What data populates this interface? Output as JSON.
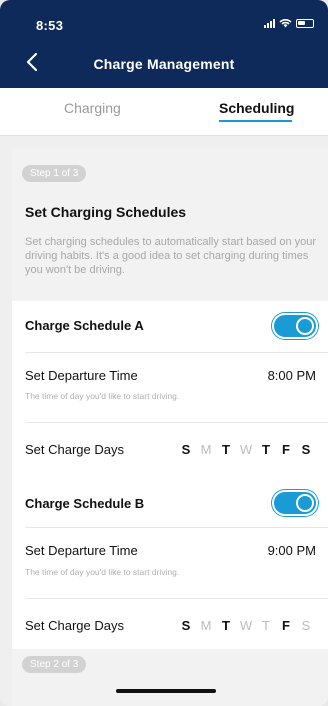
{
  "status_bar": {
    "time": "8:53"
  },
  "header": {
    "title": "Charge Management"
  },
  "tabs": [
    {
      "label": "Charging",
      "active": false
    },
    {
      "label": "Scheduling",
      "active": true
    }
  ],
  "step1": {
    "pill": "Step 1 of 3",
    "title": "Set Charging Schedules",
    "description": "Set charging schedules to automatically start based on your driving habits. It's a good idea to set charging during times you won't be driving."
  },
  "schedule_a": {
    "title": "Charge Schedule A",
    "enabled": true,
    "departure_label": "Set Departure Time",
    "departure_sub": "The time of day you'd like to start driving.",
    "departure_time": "8:00 PM",
    "days_label": "Set Charge Days",
    "days": [
      {
        "letter": "S",
        "on": true
      },
      {
        "letter": "M",
        "on": false
      },
      {
        "letter": "T",
        "on": true
      },
      {
        "letter": "W",
        "on": false
      },
      {
        "letter": "T",
        "on": true
      },
      {
        "letter": "F",
        "on": true
      },
      {
        "letter": "S",
        "on": true
      }
    ]
  },
  "schedule_b": {
    "title": "Charge Schedule B",
    "enabled": true,
    "departure_label": "Set Departure Time",
    "departure_sub": "The time of day you'd like to start driving.",
    "departure_time": "9:00 PM",
    "days_label": "Set Charge Days",
    "days": [
      {
        "letter": "S",
        "on": true
      },
      {
        "letter": "M",
        "on": false
      },
      {
        "letter": "T",
        "on": true
      },
      {
        "letter": "W",
        "on": false
      },
      {
        "letter": "T",
        "on": false
      },
      {
        "letter": "F",
        "on": true
      },
      {
        "letter": "S",
        "on": false
      }
    ]
  },
  "step2": {
    "pill": "Step 2 of 3"
  },
  "colors": {
    "header_bg": "#0e2a5a",
    "accent": "#1a9bd6"
  }
}
